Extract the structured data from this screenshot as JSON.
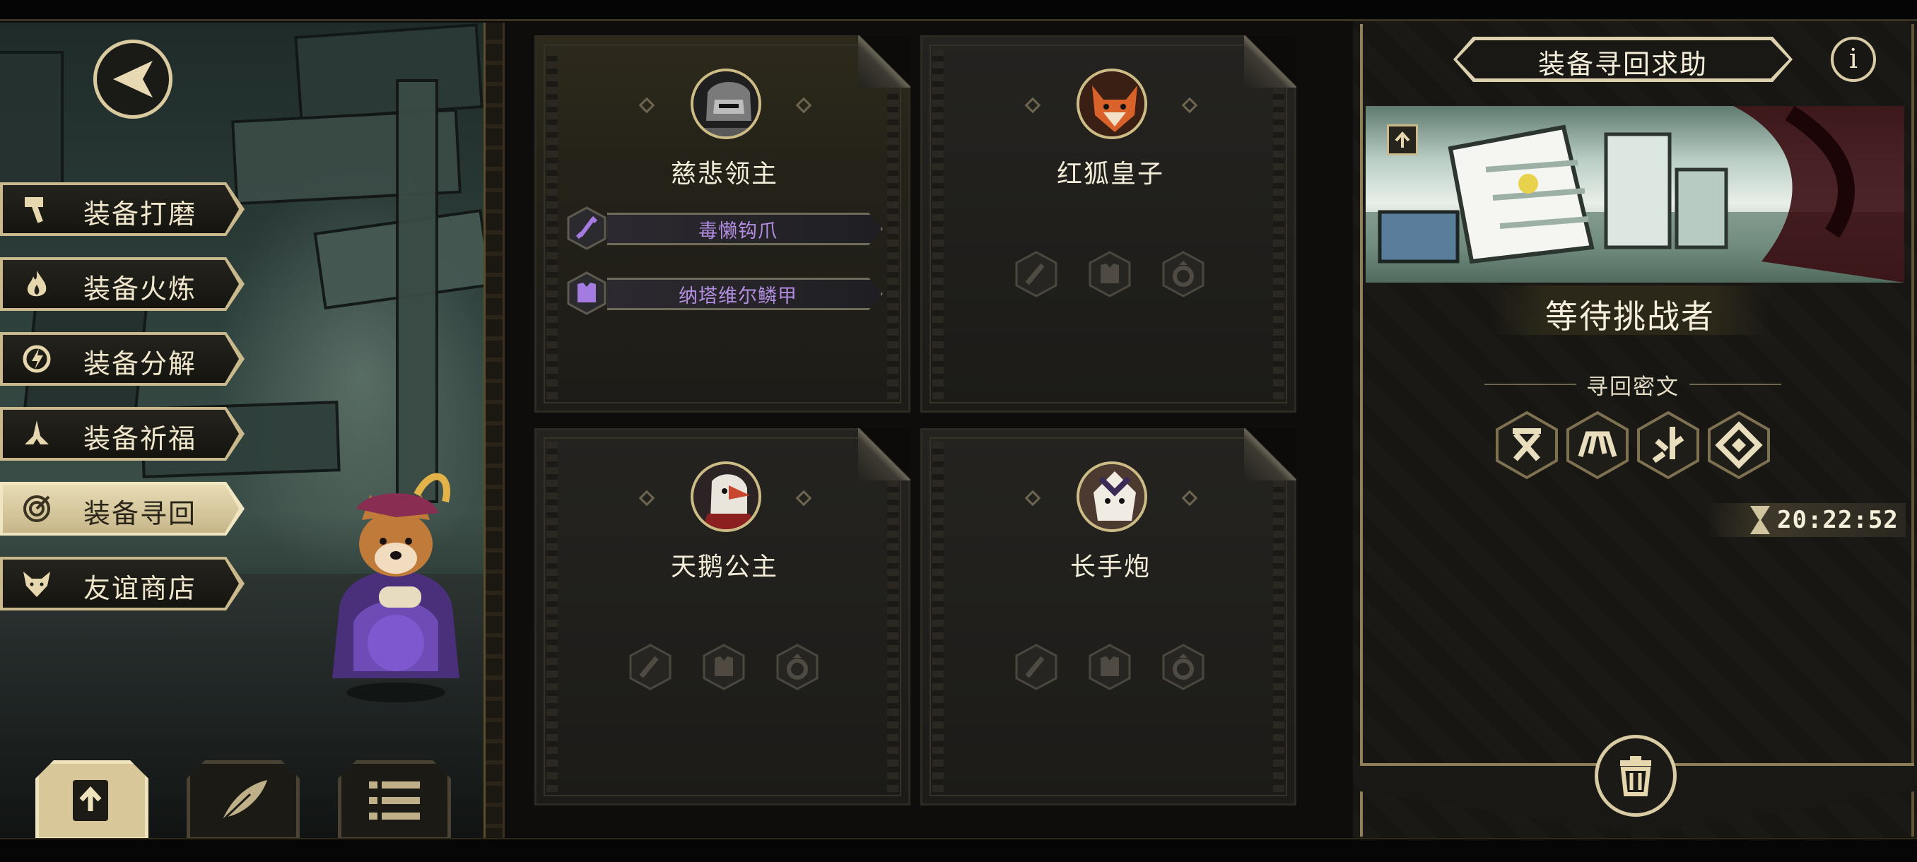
{
  "menu": {
    "items": [
      {
        "label": "装备打磨",
        "icon": "hammer-icon",
        "active": false
      },
      {
        "label": "装备火炼",
        "icon": "flame-icon",
        "active": false
      },
      {
        "label": "装备分解",
        "icon": "decompose-icon",
        "active": false
      },
      {
        "label": "装备祈福",
        "icon": "pray-hands-icon",
        "active": false
      },
      {
        "label": "装备寻回",
        "icon": "target-icon",
        "active": true
      },
      {
        "label": "友谊商店",
        "icon": "fox-icon",
        "active": false
      }
    ]
  },
  "bottom_buttons": [
    {
      "icon": "upload-icon",
      "selected": true
    },
    {
      "icon": "feather-icon",
      "selected": false
    },
    {
      "icon": "list-icon",
      "selected": false
    }
  ],
  "cards": [
    {
      "name": "慈悲领主",
      "equipment": [
        {
          "slot": "sword-icon",
          "name": "毒懒钩爪"
        },
        {
          "slot": "armor-icon",
          "name": "纳塔维尔鳞甲"
        }
      ]
    },
    {
      "name": "红狐皇子",
      "equipment": []
    },
    {
      "name": "天鹅公主",
      "equipment": []
    },
    {
      "name": "长手炮",
      "equipment": []
    }
  ],
  "right_panel": {
    "title": "装备寻回求助",
    "info_label": "i",
    "status": "等待挑战者",
    "cipher_heading": "寻回密文",
    "runes": [
      "rune-x-icon",
      "rune-arch-icon",
      "rune-fork-icon",
      "rune-diamond-icon"
    ],
    "timer": "20:22:52"
  },
  "colors": {
    "gold": "#d9caa0",
    "epic_purple": "#b38de0",
    "panel_dark": "#1c1b18"
  }
}
